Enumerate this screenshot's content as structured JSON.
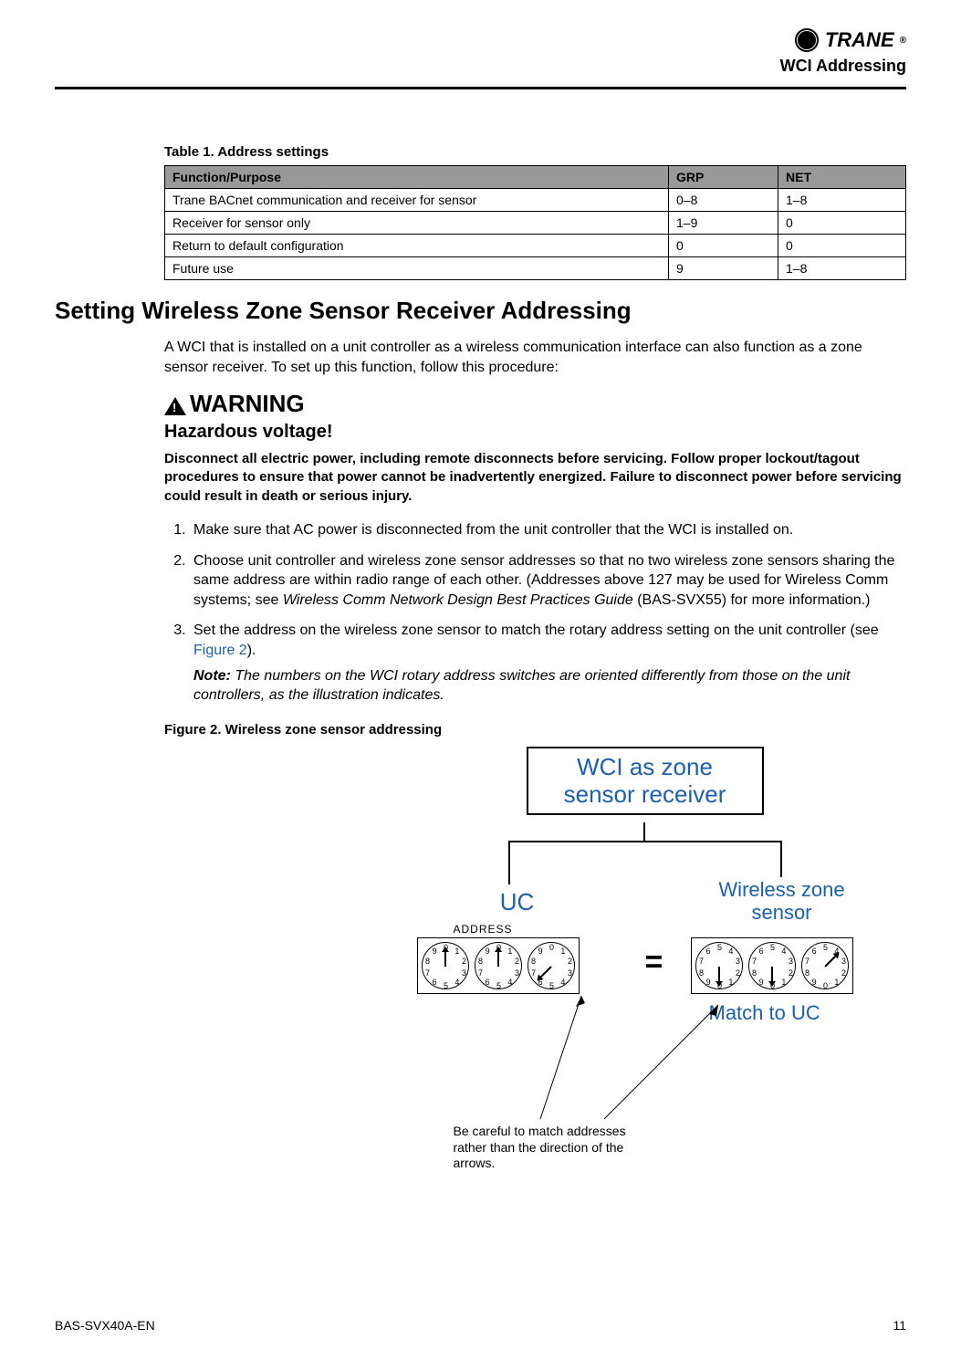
{
  "header": {
    "brand": "TRANE",
    "section": "WCI Addressing"
  },
  "table1": {
    "caption": "Table 1.    Address settings",
    "headers": [
      "Function/Purpose",
      "GRP",
      "NET"
    ],
    "rows": [
      {
        "fn": "Trane BACnet communication and receiver for sensor",
        "grp": "0–8",
        "net": "1–8"
      },
      {
        "fn": "Receiver for sensor only",
        "grp": "1–9",
        "net": "0"
      },
      {
        "fn": "Return to default configuration",
        "grp": "0",
        "net": "0"
      },
      {
        "fn": "Future use",
        "grp": "9",
        "net": "1–8"
      }
    ]
  },
  "section_heading": "Setting Wireless Zone Sensor Receiver Addressing",
  "intro": "A WCI that is installed on a unit controller as a wireless communication interface can also function as a zone sensor receiver. To set up this function, follow this procedure:",
  "warning": {
    "word": "WARNING",
    "subtitle": "Hazardous voltage!",
    "body": "Disconnect all electric power, including remote disconnects before servicing. Follow proper lockout/tagout procedures to ensure that power cannot be inadvertently energized. Failure to disconnect power before servicing could result in death or serious injury."
  },
  "steps": {
    "s1": "Make sure that AC power is disconnected from the unit controller that the WCI is installed on.",
    "s2a": "Choose unit controller and wireless zone sensor addresses so that no two wireless zone sensors sharing the same address are within radio range of each other. (Addresses above 127 may be used for Wireless Comm systems; see ",
    "s2_ref": "Wireless Comm Network Design Best Practices Guide",
    "s2b": " (BAS-SVX55) for more information.)",
    "s3a": "Set the address on the wireless zone sensor to match the rotary address setting on the unit controller (see ",
    "s3_link": "Figure 2",
    "s3b": ").",
    "note_label": "Note:",
    "note_text": " The numbers on the WCI rotary address switches are oriented differently from those on the unit controllers, as the illustration indicates."
  },
  "figure": {
    "caption": "Figure 2.   Wireless zone sensor addressing",
    "top_box_l1": "WCI as zone",
    "top_box_l2": "sensor receiver",
    "uc_label": "UC",
    "wzs_label_l1": "Wireless zone",
    "wzs_label_l2": "sensor",
    "address_label": "ADDRESS",
    "equals": "=",
    "match_label": "Match to UC",
    "caution": "Be careful to match addresses rather than the direction of the arrows.",
    "uc_dial_numbers": [
      "0",
      "1",
      "2",
      "3",
      "4",
      "5",
      "6",
      "7",
      "8",
      "9"
    ],
    "wz_dial_numbers": [
      "0",
      "1",
      "2",
      "3",
      "4",
      "5",
      "6",
      "7",
      "8",
      "9"
    ],
    "uc_arrow_angles_deg": [
      -90,
      -90,
      135
    ],
    "wz_arrow_angles_deg": [
      90,
      90,
      -45
    ]
  },
  "chart_data": {
    "type": "table",
    "title": "Table 1. Address settings",
    "columns": [
      "Function/Purpose",
      "GRP",
      "NET"
    ],
    "rows": [
      [
        "Trane BACnet communication and receiver for sensor",
        "0–8",
        "1–8"
      ],
      [
        "Receiver for sensor only",
        "1–9",
        "0"
      ],
      [
        "Return to default configuration",
        "0",
        "0"
      ],
      [
        "Future use",
        "9",
        "1–8"
      ]
    ]
  },
  "footer": {
    "doc_id": "BAS-SVX40A-EN",
    "page": "11"
  }
}
